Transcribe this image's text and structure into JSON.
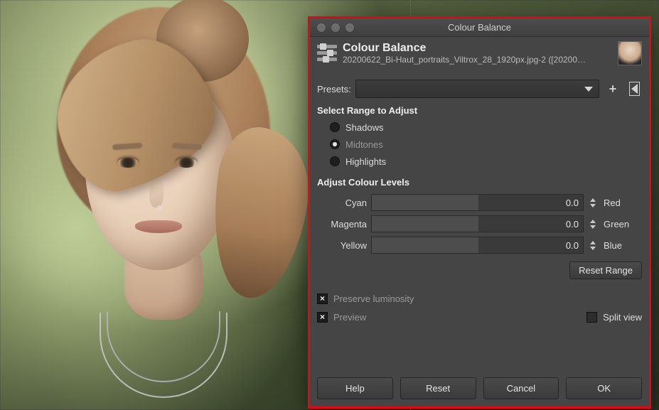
{
  "window": {
    "title": "Colour Balance"
  },
  "header": {
    "title": "Colour Balance",
    "subtitle": "20200622_Bi-Haut_portraits_Viltrox_28_1920px.jpg-2 ([20200…"
  },
  "presets": {
    "label": "Presets:",
    "selected": ""
  },
  "range": {
    "section": "Select Range to Adjust",
    "options": {
      "shadows": "Shadows",
      "midtones": "Midtones",
      "highlights": "Highlights"
    },
    "selected": "midtones"
  },
  "levels": {
    "section": "Adjust Colour Levels",
    "rows": [
      {
        "left": "Cyan",
        "right": "Red",
        "value": "0.0"
      },
      {
        "left": "Magenta",
        "right": "Green",
        "value": "0.0"
      },
      {
        "left": "Yellow",
        "right": "Blue",
        "value": "0.0"
      }
    ],
    "reset_range": "Reset Range"
  },
  "checks": {
    "preserve": {
      "label": "Preserve luminosity",
      "checked": true
    },
    "preview": {
      "label": "Preview",
      "checked": true
    },
    "split": {
      "label": "Split view",
      "checked": false
    }
  },
  "buttons": {
    "help": "Help",
    "reset": "Reset",
    "cancel": "Cancel",
    "ok": "OK"
  }
}
